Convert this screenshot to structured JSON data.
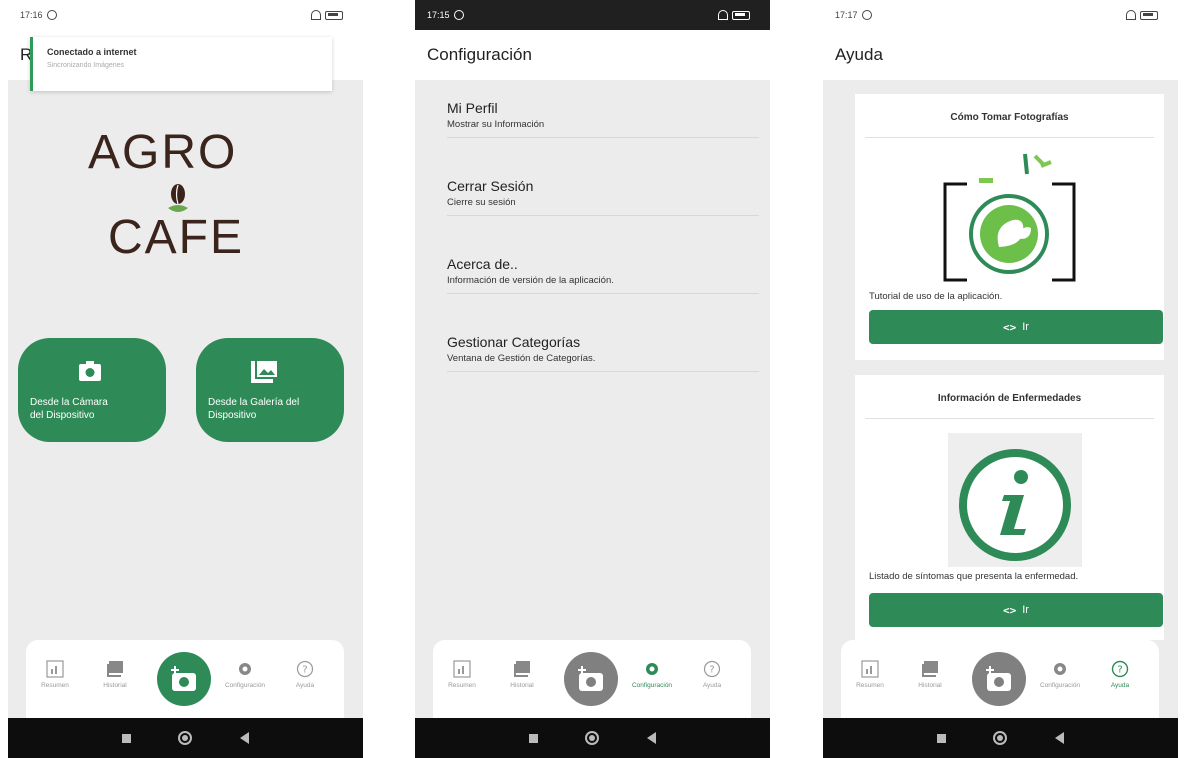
{
  "colors": {
    "accent": "#2e8b57",
    "background": "#ececec",
    "logo": "#3a241c",
    "fab_inactive": "#808080"
  },
  "phone1": {
    "status": {
      "time": "17:16"
    },
    "appbar_partial": "R",
    "toast": {
      "title": "Conectado a internet",
      "subtitle": "Sincronizando Imágenes"
    },
    "logo": {
      "line1": "AGRO",
      "line2": "CAFE"
    },
    "camera_button": {
      "label_line1": "Desde la Cámara",
      "label_line2": "del Dispositivo",
      "icon": "camera-icon"
    },
    "gallery_button": {
      "label_line1": "Desde la Galería del",
      "label_line2": "Dispositivo",
      "icon": "gallery-icon"
    }
  },
  "phone2": {
    "status": {
      "time": "17:15"
    },
    "title": "Configuración",
    "items": [
      {
        "title": "Mi Perfil",
        "subtitle": "Mostrar su Información"
      },
      {
        "title": "Cerrar Sesión",
        "subtitle": "Cierre su sesión"
      },
      {
        "title": "Acerca de..",
        "subtitle": "Información de versión de la aplicación."
      },
      {
        "title": "Gestionar Categorías",
        "subtitle": "Ventana de Gestión de Categorías."
      }
    ]
  },
  "phone3": {
    "status": {
      "time": "17:17"
    },
    "title": "Ayuda",
    "cards": [
      {
        "title": "Cómo Tomar Fotografías",
        "text": "Tutorial de uso de la aplicación.",
        "button": "Ir",
        "icon": "leaf-camera-icon"
      },
      {
        "title": "Información de Enfermedades",
        "text": "Listado de síntomas que presenta la enfermedad.",
        "button": "Ir",
        "icon": "info-icon"
      }
    ]
  },
  "nav": {
    "items": [
      "Resumen",
      "Historial",
      "Configuración",
      "Ayuda"
    ],
    "icons": [
      "chart-icon",
      "history-icon",
      "camera-add-icon",
      "gear-icon",
      "help-icon"
    ],
    "active_phone2": "Configuración",
    "active_phone3": "Ayuda"
  }
}
